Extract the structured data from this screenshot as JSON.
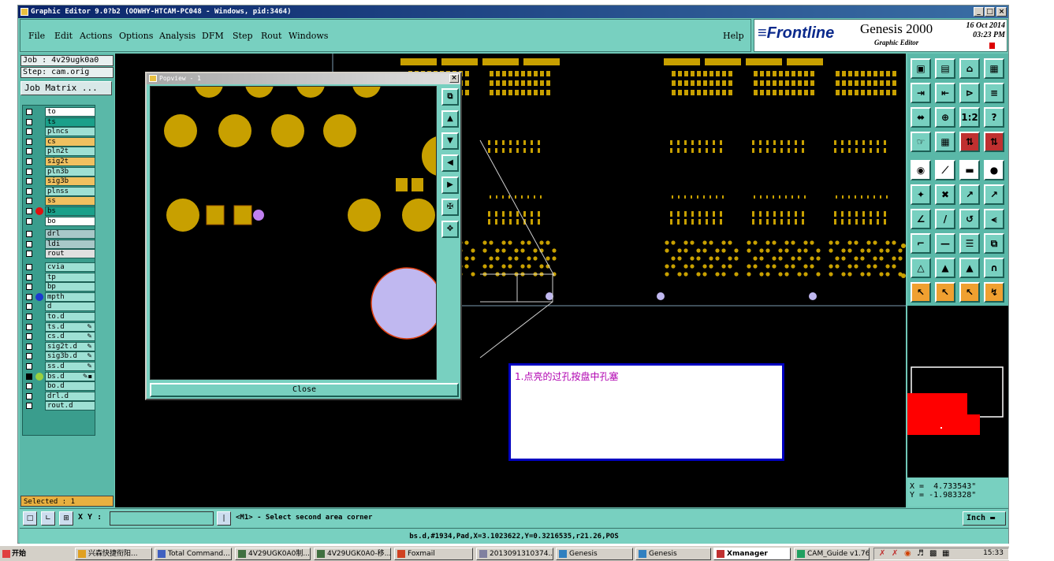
{
  "window": {
    "title": "Graphic Editor 9.0?b2  (OOWHY-HTCAM-PC048 - Windows, pid:3464)"
  },
  "menu": [
    "File",
    "Edit",
    "Actions",
    "Options",
    "Analysis",
    "DFM",
    "Step",
    "Rout",
    "Windows"
  ],
  "help_label": "Help",
  "brand": {
    "logo": "≡Frontline",
    "product": "Genesis 2000",
    "subtitle": "Graphic Editor",
    "date": "16 Oct 2014",
    "time": "03:23 PM"
  },
  "job": {
    "job_line": "Job : 4v29ugk0a0",
    "step_line": "Step: cam.orig",
    "matrix_button": "Job Matrix ..."
  },
  "layers": [
    {
      "name": "to",
      "color": "#ffffff",
      "dot": ""
    },
    {
      "name": "ts",
      "color": "#1aa08a",
      "dot": ""
    },
    {
      "name": "plncs",
      "color": "#9ee0d4",
      "dot": ""
    },
    {
      "name": "cs",
      "color": "#f0c060",
      "dot": ""
    },
    {
      "name": "pln2t",
      "color": "#9ee0d4",
      "dot": ""
    },
    {
      "name": "sig2t",
      "color": "#f0c060",
      "dot": ""
    },
    {
      "name": "pln3b",
      "color": "#9ee0d4",
      "dot": ""
    },
    {
      "name": "sig3b",
      "color": "#f0c060",
      "dot": ""
    },
    {
      "name": "plnss",
      "color": "#9ee0d4",
      "dot": ""
    },
    {
      "name": "ss",
      "color": "#f0c060",
      "dot": ""
    },
    {
      "name": "bs",
      "color": "#1aa08a",
      "dot": "#e01010"
    },
    {
      "name": "bo",
      "color": "#ffffff",
      "dot": ""
    },
    {
      "name": "drl",
      "color": "#a8c8c8",
      "dot": ""
    },
    {
      "name": "ldi",
      "color": "#a8c8c8",
      "dot": ""
    },
    {
      "name": "rout",
      "color": "#e0e0e0",
      "dot": ""
    },
    {
      "name": "cvia",
      "color": "#9ee0d4",
      "dot": ""
    },
    {
      "name": "tp",
      "color": "#9ee0d4",
      "dot": ""
    },
    {
      "name": "bp",
      "color": "#9ee0d4",
      "dot": ""
    },
    {
      "name": "mpth",
      "color": "#9ee0d4",
      "dot": "#1a3ad0"
    },
    {
      "name": "d",
      "color": "#9ee0d4",
      "dot": ""
    },
    {
      "name": "to.d",
      "color": "#9ee0d4",
      "dot": ""
    },
    {
      "name": "ts.d",
      "color": "#9ee0d4",
      "dot": "",
      "mark": "✎"
    },
    {
      "name": "cs.d",
      "color": "#9ee0d4",
      "dot": "",
      "mark": "✎"
    },
    {
      "name": "sig2t.d",
      "color": "#9ee0d4",
      "dot": "",
      "mark": "✎"
    },
    {
      "name": "sig3b.d",
      "color": "#9ee0d4",
      "dot": "",
      "mark": "✎"
    },
    {
      "name": "ss.d",
      "color": "#9ee0d4",
      "dot": "",
      "mark": "✎"
    },
    {
      "name": "bs.d",
      "color": "#9ee0d4",
      "dot": "#9ad040",
      "mark": "✎▪"
    },
    {
      "name": "bo.d",
      "color": "#9ee0d4",
      "dot": ""
    },
    {
      "name": "drl.d",
      "color": "#9ee0d4",
      "dot": ""
    },
    {
      "name": "rout.d",
      "color": "#9ee0d4",
      "dot": ""
    }
  ],
  "selected": "Selected : 1",
  "coords": {
    "x": "X =  4.733543\"",
    "y": "Y = -1.983328\""
  },
  "command": {
    "xy_label": "X Y :",
    "prompt": "<M1> - Select second area corner",
    "units": "Inch"
  },
  "status_line": "bs.d,#1934,Pad,X=3.1023622,Y=0.3216535,r21.26,POS",
  "popview": {
    "title": "Popview - 1",
    "close_label": "Close"
  },
  "note": "1.点亮的过孔按盘中孔塞",
  "taskbar": {
    "start": "开始",
    "tasks": [
      "兴森快捷衔阳...",
      "Total Command...",
      "4V29UGK0A0制...",
      "4V29UGK0A0-移...",
      "Foxmail",
      "2013091310374...",
      "Genesis",
      "Genesis",
      "Xmanager",
      "CAM_Guide v1.76"
    ],
    "clock": "15:33"
  },
  "colors": {
    "pad": "#c8a000",
    "via": "#c0b8f0",
    "ui": "#78d0c0",
    "highlight": "#ff0000"
  }
}
